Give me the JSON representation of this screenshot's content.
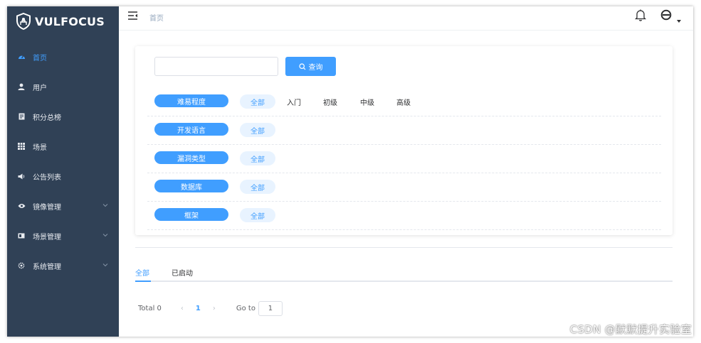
{
  "brand": {
    "name": "VULFOCUS"
  },
  "sidebar": {
    "items": [
      {
        "label": "首页",
        "icon": "dashboard-icon",
        "active": true
      },
      {
        "label": "用户",
        "icon": "user-icon"
      },
      {
        "label": "积分总榜",
        "icon": "document-icon"
      },
      {
        "label": "场景",
        "icon": "grid-icon"
      },
      {
        "label": "公告列表",
        "icon": "megaphone-icon"
      },
      {
        "label": "镜像管理",
        "icon": "eye-icon",
        "expandable": true
      },
      {
        "label": "场景管理",
        "icon": "card-icon",
        "expandable": true
      },
      {
        "label": "系统管理",
        "icon": "gear-icon",
        "expandable": true
      }
    ]
  },
  "header": {
    "breadcrumb": "首页"
  },
  "search": {
    "placeholder": "",
    "button_label": "查询"
  },
  "filters": [
    {
      "category": "难易程度",
      "active": "全部",
      "options": [
        "入门",
        "初级",
        "中级",
        "高级"
      ]
    },
    {
      "category": "开发语言",
      "active": "全部",
      "options": []
    },
    {
      "category": "漏洞类型",
      "active": "全部",
      "options": []
    },
    {
      "category": "数据库",
      "active": "全部",
      "options": []
    },
    {
      "category": "框架",
      "active": "全部",
      "options": []
    }
  ],
  "tabs": [
    {
      "label": "全部",
      "active": true
    },
    {
      "label": "已启动",
      "active": false
    }
  ],
  "pagination": {
    "total": "Total 0",
    "current_page": "1",
    "goto_label": "Go to",
    "goto_value": "1"
  },
  "watermark": "CSDN @默默提升实验室",
  "colors": {
    "sidebar": "#304156",
    "accent": "#409EFF"
  }
}
